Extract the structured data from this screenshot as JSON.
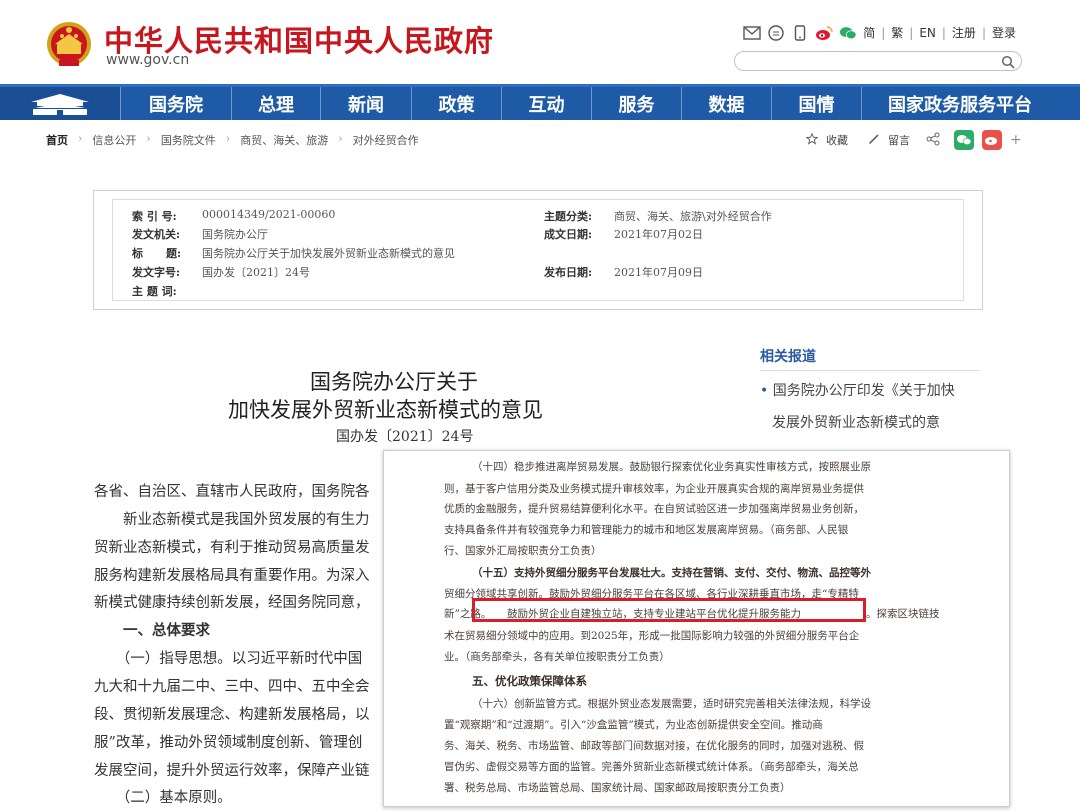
{
  "header": {
    "site_title": "中华人民共和国中央人民政府",
    "site_url": "www.gov.cn",
    "lang_links": [
      "简",
      "繁",
      "EN",
      "注册",
      "登录"
    ],
    "icons": [
      "mail-icon",
      "chat-icon",
      "phone-icon",
      "weibo-icon",
      "wechat-icon"
    ],
    "search_placeholder": ""
  },
  "nav": {
    "items": [
      "国务院",
      "总理",
      "新闻",
      "政策",
      "互动",
      "服务",
      "数据",
      "国情",
      "国家政务服务平台"
    ]
  },
  "breadcrumb": {
    "items": [
      "首页",
      "信息公开",
      "国务院文件",
      "商贸、海关、旅游",
      "对外经贸合作"
    ]
  },
  "actions": {
    "favorite": "收藏",
    "comment": "留言"
  },
  "info": {
    "index_label": "索 引 号:",
    "index_value": "000014349/2021-00060",
    "subject_label": "主题分类:",
    "subject_value": "商贸、海关、旅游\\对外经贸合作",
    "issuer_label": "发文机关:",
    "issuer_value": "国务院办公厅",
    "date_label": "成文日期:",
    "date_value": "2021年07月02日",
    "title_label": "标      题:",
    "title_value": "国务院办公厅关于加快发展外贸新业态新模式的意见",
    "docno_label": "发文字号:",
    "docno_value": "国办发〔2021〕24号",
    "publish_label": "发布日期:",
    "publish_value": "2021年07月09日",
    "keywords_label": "主 题 词:"
  },
  "article": {
    "title_line1": "国务院办公厅关于",
    "title_line2": "加快发展外贸新业态新模式的意见",
    "doc_number": "国办发〔2021〕24号",
    "lines": [
      "各省、自治区、直辖市人民政府，国务院各",
      "　　新业态新模式是我国外贸发展的有生力",
      "贸新业态新模式，有利于推动贸易高质量发",
      "服务构建新发展格局具有重要作用。为深入",
      "新模式健康持续创新发展，经国务院同意，",
      "　　一、总体要求",
      "　　（一）指导思想。以习近平新时代中国",
      "九大和十九届二中、三中、四中、五中全会",
      "段、贯彻新发展理念、构建新发展格局，以",
      "服”改革，推动外贸领域制度创新、管理创",
      "发展空间，提升外贸运行效率，保障产业链",
      "　　（二）基本原则。"
    ]
  },
  "related": {
    "heading": "相关报道",
    "item_line1": "国务院办公厅印发《关于加快",
    "item_line2": "发展外贸新业态新模式的意"
  },
  "excerpt": {
    "lines": [
      "（十四）稳步推进离岸贸易发展。鼓励银行探索优化业务真实性审核方式，按照展业原",
      "则，基于客户信用分类及业务模式提升审核效率，为企业开展真实合规的离岸贸易业务提供",
      "优质的金融服务，提升贸易结算便利化水平。在自贸试验区进一步加强离岸贸易业务创新，",
      "支持具备条件并有较强竞争力和管理能力的城市和地区发展离岸贸易。（商务部、人民银",
      "行、国家外汇局按职责分工负责）",
      "（十五）支持外贸细分服务平台发展壮大。支持在营销、支付、交付、物流、品控等外",
      "贸细分领域共享创新。鼓励外贸细分服务平台在各区域、各行业深耕垂直市场，走“专精特",
      "新”之路。",
      "鼓励外贸企业自建独立站，支持专业建站平台优化提升服务能力",
      "。探索区块链技",
      "术在贸易细分领域中的应用。到2025年，形成一批国际影响力较强的外贸细分服务平台企",
      "业。（商务部牵头，各有关单位按职责分工负责）",
      "五、优化政策保障体系",
      "（十六）创新监管方式。根据外贸业态发展需要，适时研究完善相关法律法规，科学设",
      "置“观察期”和“过渡期”。引入“沙盒监管”模式，为业态创新提供安全空间。推动商",
      "务、海关、税务、市场监管、邮政等部门间数据对接，在优化服务的同时，加强对逃税、假",
      "冒伪劣、虚假交易等方面的监管。完善外贸新业态新模式统计体系。（商务部牵头，海关总",
      "署、税务总局、市场监管总局、国家统计局、国家邮政局按职责分工负责）"
    ]
  },
  "colors": {
    "brand_red": "#c7161d",
    "nav_blue": "#1f5aa6",
    "highlight_red": "#d81e2a",
    "related_blue": "#2c5aa0"
  }
}
